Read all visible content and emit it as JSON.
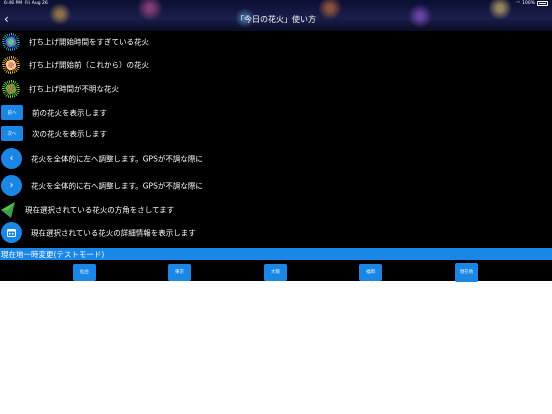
{
  "statusbar": {
    "time": "6:46 PM",
    "date": "Fri Aug 26",
    "battery": "100%"
  },
  "header": {
    "title": "「今日の花火」使い方",
    "back_icon": "chevron-left-icon"
  },
  "legend": {
    "fw_past": "打ち上げ開始時間をすぎている花火",
    "fw_upcoming": "打ち上げ開始前（これから）の花火",
    "fw_unknown": "打ち上げ時間が不明な花火",
    "prev_button": "前へ",
    "prev_text": "前の花火を表示します",
    "next_button": "次へ",
    "next_text": "次の花火を表示します",
    "left_text": "花火を全体的に左へ調整します。GPSが不調な際に",
    "right_text": "花火を全体的に右へ調整します。GPSが不調な際に",
    "direction_text": "現在選択されている花火の方角をさしてます",
    "detail_text": "現在選択されている花火の詳細情報を表示します"
  },
  "location": {
    "bar_label": "現在地一時変更(テストモード)",
    "cities": [
      "仙台",
      "東京",
      "大阪",
      "福岡",
      "現在地"
    ]
  }
}
